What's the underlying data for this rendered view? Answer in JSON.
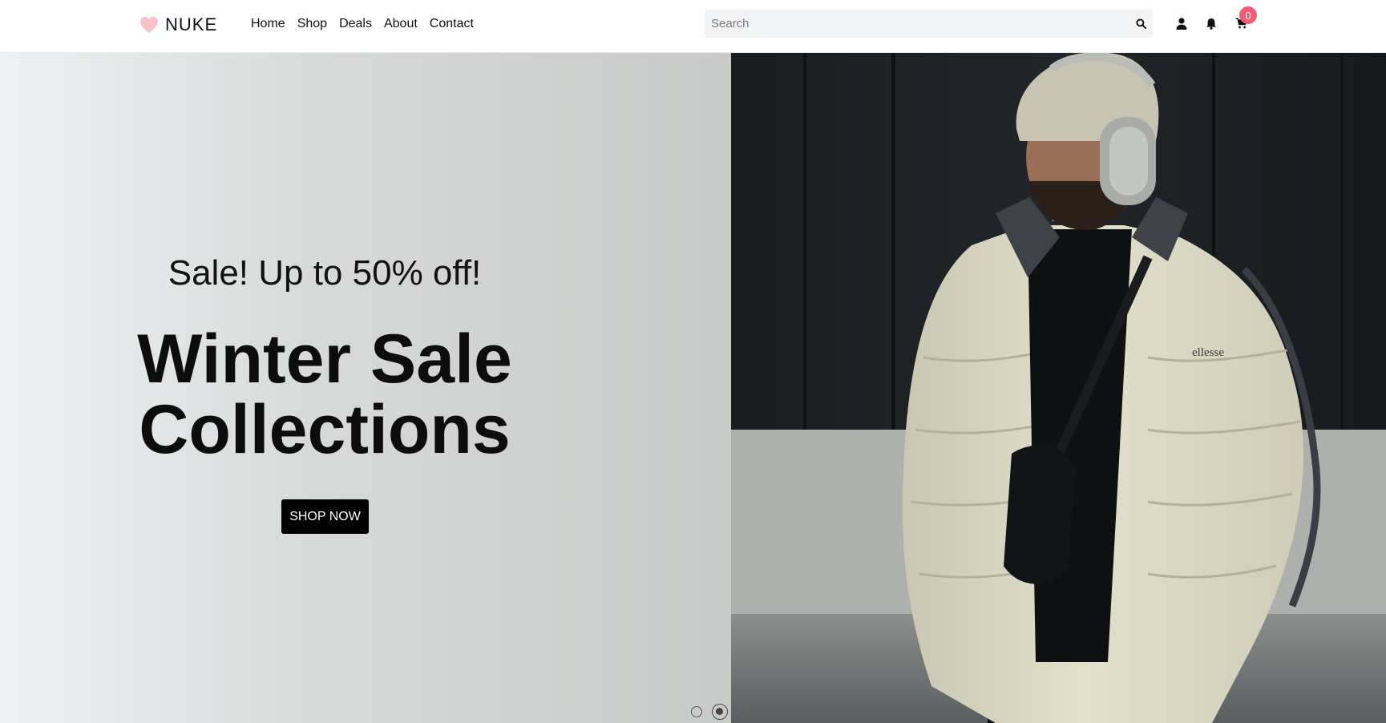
{
  "brand": {
    "name": "NUKE",
    "logo_color": "#f8c0c8"
  },
  "nav": {
    "items": [
      {
        "label": "Home"
      },
      {
        "label": "Shop"
      },
      {
        "label": "Deals"
      },
      {
        "label": "About"
      },
      {
        "label": "Contact"
      }
    ]
  },
  "search": {
    "placeholder": "Search",
    "value": "",
    "icon": "search-icon"
  },
  "header_icons": {
    "user_icon": "user-icon",
    "bell_icon": "bell-icon",
    "cart_icon": "cart-icon",
    "cart_count": "0",
    "badge_color": "#f25c77"
  },
  "hero": {
    "subtitle": "Sale! Up to 50% off!",
    "headline_line1": "Winter Sale",
    "headline_line2": "Collections",
    "cta_label": "SHOP NOW",
    "brand_on_jacket": "ellesse",
    "slides_count": 3,
    "active_slide": 2
  }
}
